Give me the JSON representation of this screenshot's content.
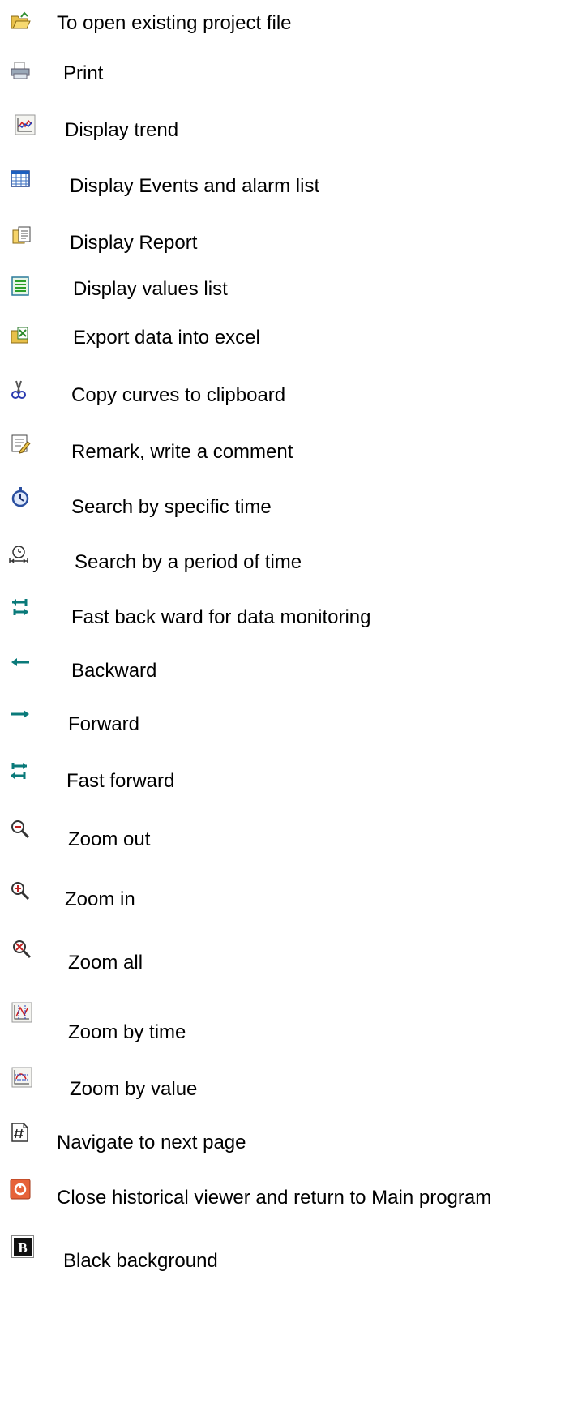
{
  "items": [
    {
      "icon": "open-folder-icon",
      "label": "To open existing project file"
    },
    {
      "icon": "printer-icon",
      "label": "Print"
    },
    {
      "icon": "trend-chart-icon",
      "label": "Display trend"
    },
    {
      "icon": "event-list-icon",
      "label": "Display Events and alarm list"
    },
    {
      "icon": "report-icon",
      "label": "Display Report"
    },
    {
      "icon": "values-list-icon",
      "label": "Display values list"
    },
    {
      "icon": "export-excel-icon",
      "label": "Export data into excel"
    },
    {
      "icon": "scissors-icon",
      "label": "Copy curves to clipboard"
    },
    {
      "icon": "remark-icon",
      "label": "Remark, write a comment"
    },
    {
      "icon": "stopwatch-icon",
      "label": "Search by specific time"
    },
    {
      "icon": "period-time-icon",
      "label": "Search by a period of time"
    },
    {
      "icon": "fast-backward-icon",
      "label": "Fast back ward for data monitoring"
    },
    {
      "icon": "backward-icon",
      "label": "Backward"
    },
    {
      "icon": "forward-icon",
      "label": "Forward"
    },
    {
      "icon": "fast-forward-icon",
      "label": "Fast forward"
    },
    {
      "icon": "zoom-out-icon",
      "label": "Zoom out"
    },
    {
      "icon": "zoom-in-icon",
      "label": "Zoom in"
    },
    {
      "icon": "zoom-all-icon",
      "label": "Zoom all"
    },
    {
      "icon": "zoom-by-time-icon",
      "label": "Zoom by time"
    },
    {
      "icon": "zoom-by-value-icon",
      "label": "Zoom by value"
    },
    {
      "icon": "next-page-icon",
      "label": "Navigate to next page"
    },
    {
      "icon": "close-viewer-icon",
      "label": "Close historical viewer and return to Main program"
    },
    {
      "icon": "black-background-icon",
      "label": "Black background",
      "glyph": "B"
    }
  ]
}
